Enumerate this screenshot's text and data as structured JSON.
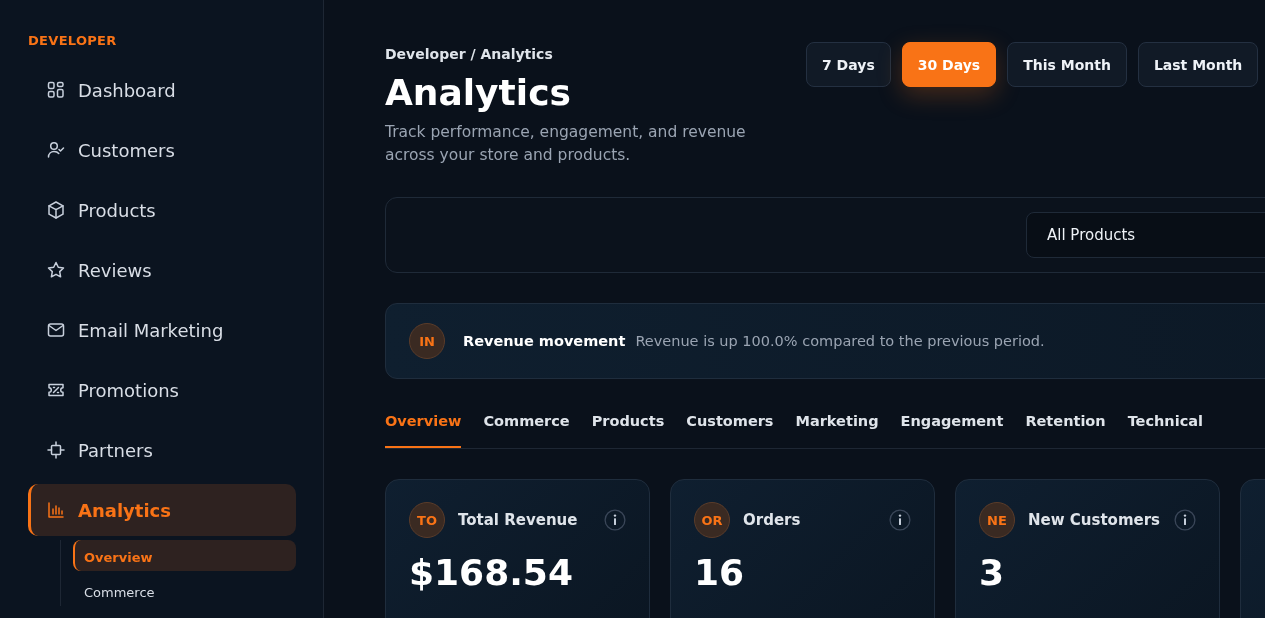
{
  "sidebar": {
    "section": "DEVELOPER",
    "items": [
      {
        "label": "Dashboard",
        "kind": "grid",
        "selected": false
      },
      {
        "label": "Customers",
        "kind": "user",
        "selected": false
      },
      {
        "label": "Products",
        "kind": "box",
        "selected": false
      },
      {
        "label": "Reviews",
        "kind": "star",
        "selected": false
      },
      {
        "label": "Email Marketing",
        "kind": "mail",
        "selected": false
      },
      {
        "label": "Promotions",
        "kind": "ticket",
        "selected": false
      },
      {
        "label": "Partners",
        "kind": "chip",
        "selected": false
      },
      {
        "label": "Analytics",
        "kind": "chart",
        "selected": true,
        "children": [
          {
            "label": "Overview",
            "selected": true
          },
          {
            "label": "Commerce",
            "selected": false
          }
        ]
      }
    ]
  },
  "breadcrumb": "Developer / Analytics",
  "title": "Analytics",
  "subtitle": "Track performance, engagement, and revenue across your store and products.",
  "ranges": [
    {
      "label": "7 Days",
      "selected": false
    },
    {
      "label": "30 Days",
      "selected": true
    },
    {
      "label": "This Month",
      "selected": false
    },
    {
      "label": "Last Month",
      "selected": false
    }
  ],
  "filter": {
    "value": "All Products"
  },
  "insight": {
    "badge": "IN",
    "title": "Revenue movement",
    "text": "Revenue is up 100.0% compared to the previous period."
  },
  "tabs": [
    {
      "label": "Overview",
      "selected": true
    },
    {
      "label": "Commerce",
      "selected": false
    },
    {
      "label": "Products",
      "selected": false
    },
    {
      "label": "Customers",
      "selected": false
    },
    {
      "label": "Marketing",
      "selected": false
    },
    {
      "label": "Engagement",
      "selected": false
    },
    {
      "label": "Retention",
      "selected": false
    },
    {
      "label": "Technical",
      "selected": false
    }
  ],
  "metrics": [
    {
      "badge": "TO",
      "title": "Total Revenue",
      "value": "$168.54"
    },
    {
      "badge": "OR",
      "title": "Orders",
      "value": "16"
    },
    {
      "badge": "NE",
      "title": "New Customers",
      "value": "3"
    }
  ]
}
